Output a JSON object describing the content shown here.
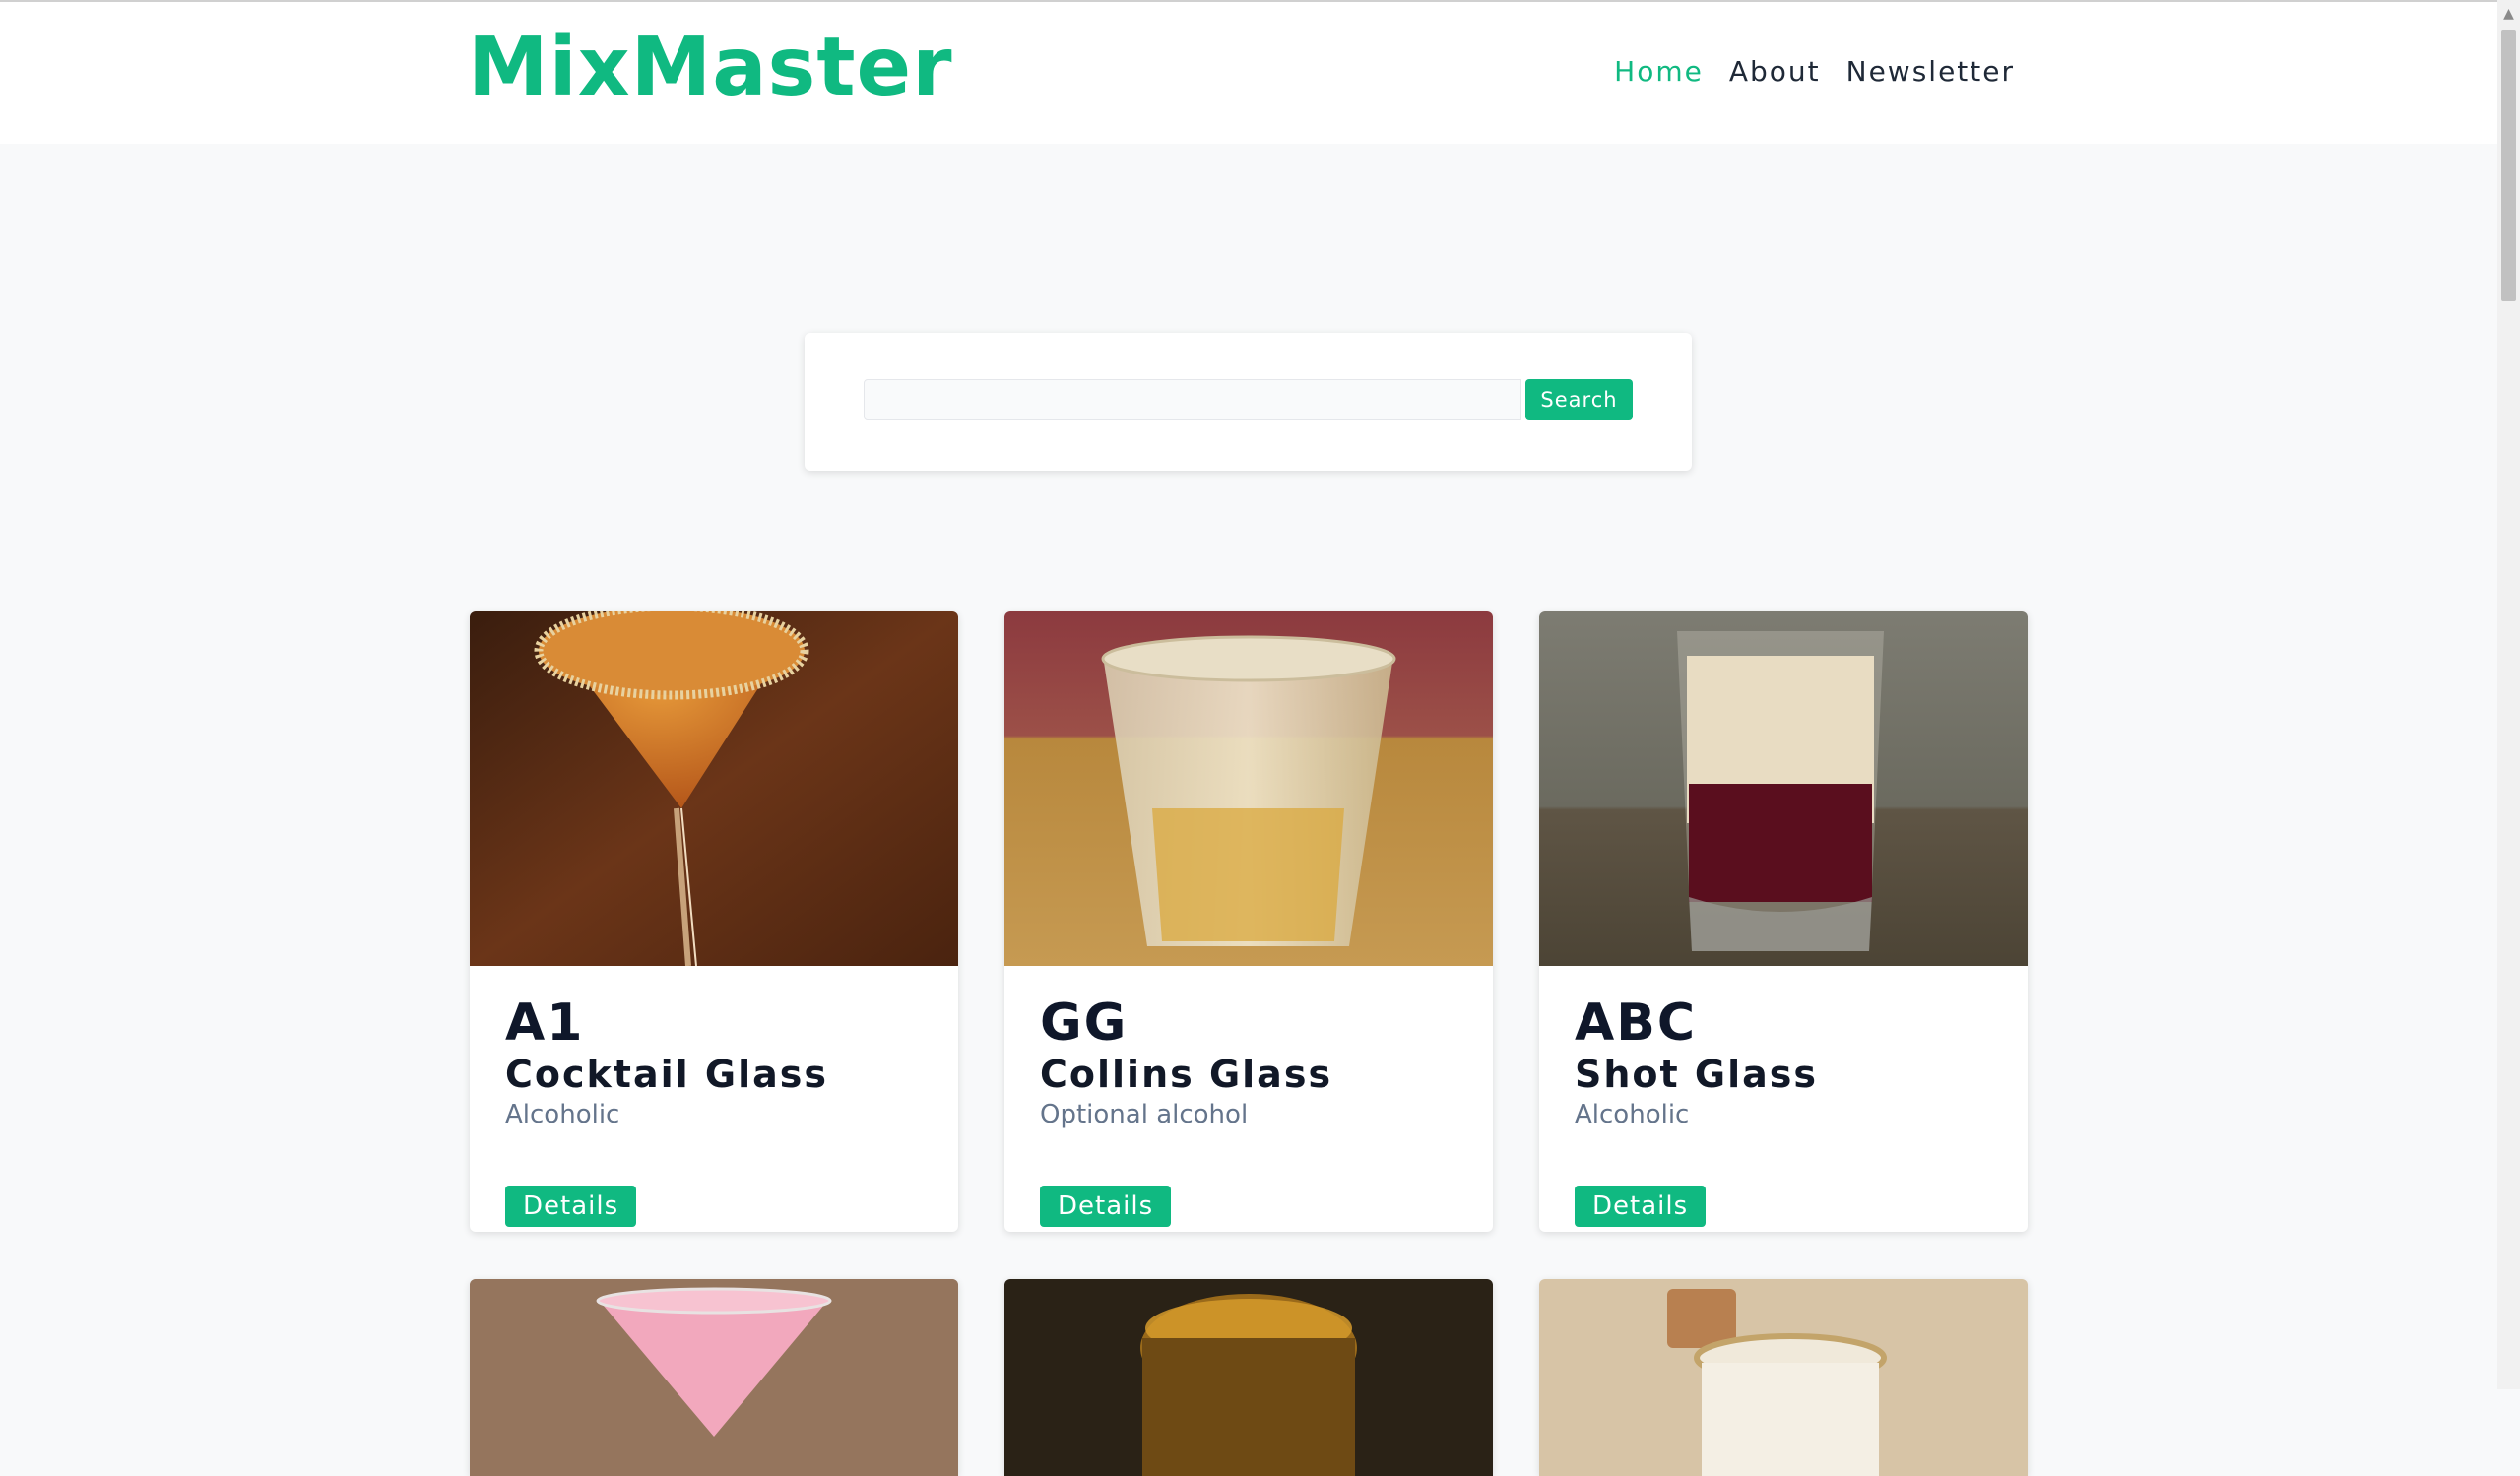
{
  "brand": "MixMaster",
  "nav": [
    {
      "label": "Home",
      "active": true
    },
    {
      "label": "About",
      "active": false
    },
    {
      "label": "Newsletter",
      "active": false
    }
  ],
  "search": {
    "value": "",
    "placeholder": "",
    "button_label": "Search"
  },
  "cards": [
    {
      "name": "A1",
      "glass": "Cocktail Glass",
      "alcoholic": "Alcoholic",
      "button_label": "Details"
    },
    {
      "name": "GG",
      "glass": "Collins Glass",
      "alcoholic": "Optional alcohol",
      "button_label": "Details"
    },
    {
      "name": "ABC",
      "glass": "Shot Glass",
      "alcoholic": "Alcoholic",
      "button_label": "Details"
    }
  ],
  "colors": {
    "accent": "#10b981",
    "page_bg": "#f8f9fa",
    "title": "#0f172a",
    "muted": "#64748b"
  }
}
